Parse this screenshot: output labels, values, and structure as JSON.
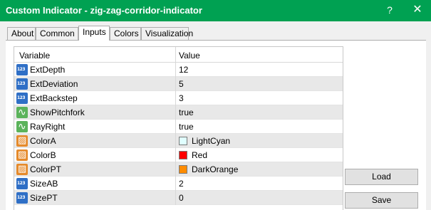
{
  "window": {
    "title": "Custom Indicator - zig-zag-corridor-indicator",
    "help_label": "?",
    "close_label": "✕"
  },
  "tabs": [
    {
      "label": "About"
    },
    {
      "label": "Common"
    },
    {
      "label": "Inputs"
    },
    {
      "label": "Colors"
    },
    {
      "label": "Visualization"
    }
  ],
  "active_tab": "Inputs",
  "grid": {
    "headers": {
      "variable": "Variable",
      "value": "Value"
    },
    "rows": [
      {
        "name": "ExtDepth",
        "value": "12",
        "icon": "number-icon"
      },
      {
        "name": "ExtDeviation",
        "value": "5",
        "icon": "number-icon"
      },
      {
        "name": "ExtBackstep",
        "value": "3",
        "icon": "number-icon"
      },
      {
        "name": "ShowPitchfork",
        "value": "true",
        "icon": "boolean-icon"
      },
      {
        "name": "RayRight",
        "value": "true",
        "icon": "boolean-icon"
      },
      {
        "name": "ColorA",
        "value": "LightCyan",
        "icon": "color-icon",
        "swatch": "#e0ffff"
      },
      {
        "name": "ColorB",
        "value": "Red",
        "icon": "color-icon",
        "swatch": "#ff0000"
      },
      {
        "name": "ColorPT",
        "value": "DarkOrange",
        "icon": "color-icon",
        "swatch": "#ff8c00"
      },
      {
        "name": "SizeAB",
        "value": "2",
        "icon": "number-icon"
      },
      {
        "name": "SizePT",
        "value": "0",
        "icon": "number-icon"
      }
    ]
  },
  "buttons": {
    "load": "Load",
    "save": "Save"
  },
  "colors": {
    "titlebar": "#00a152"
  }
}
